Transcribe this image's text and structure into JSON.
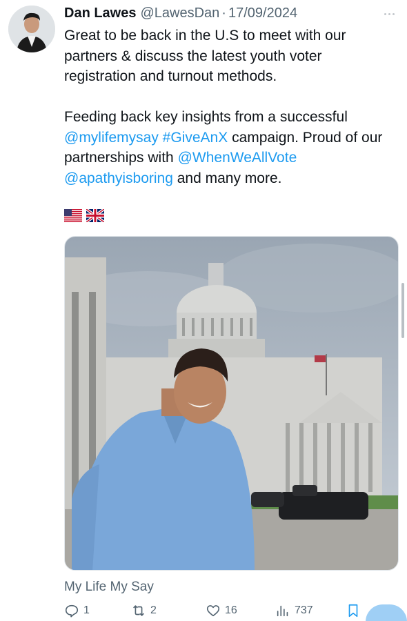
{
  "tweet": {
    "author_name": "Dan Lawes",
    "author_handle": "@LawesDan",
    "separator": "·",
    "date": "17/09/2024",
    "text": {
      "line1": "Great to be back in the U.S to meet with our partners & discuss the latest youth voter registration and turnout methods.",
      "para2_prefix": "Feeding back key insights from a successful ",
      "mention_mylifemysay": "@mylifemysay",
      "hashtag": "#GiveAnX",
      "para2_mid": " campaign. Proud of our partnerships with ",
      "mention_whenweallvote": "@WhenWeAllVote",
      "mention_apathy": "@apathyisboring",
      "para2_suffix": " and many more."
    },
    "flags": [
      "us-flag-icon",
      "uk-flag-icon"
    ],
    "source_label": "My Life My Say",
    "actions": {
      "replies": "1",
      "retweets": "2",
      "likes": "16",
      "views": "737"
    }
  },
  "colors": {
    "link": "#1d9bf0",
    "secondary_text": "#536471",
    "primary_text": "#0f1419"
  }
}
